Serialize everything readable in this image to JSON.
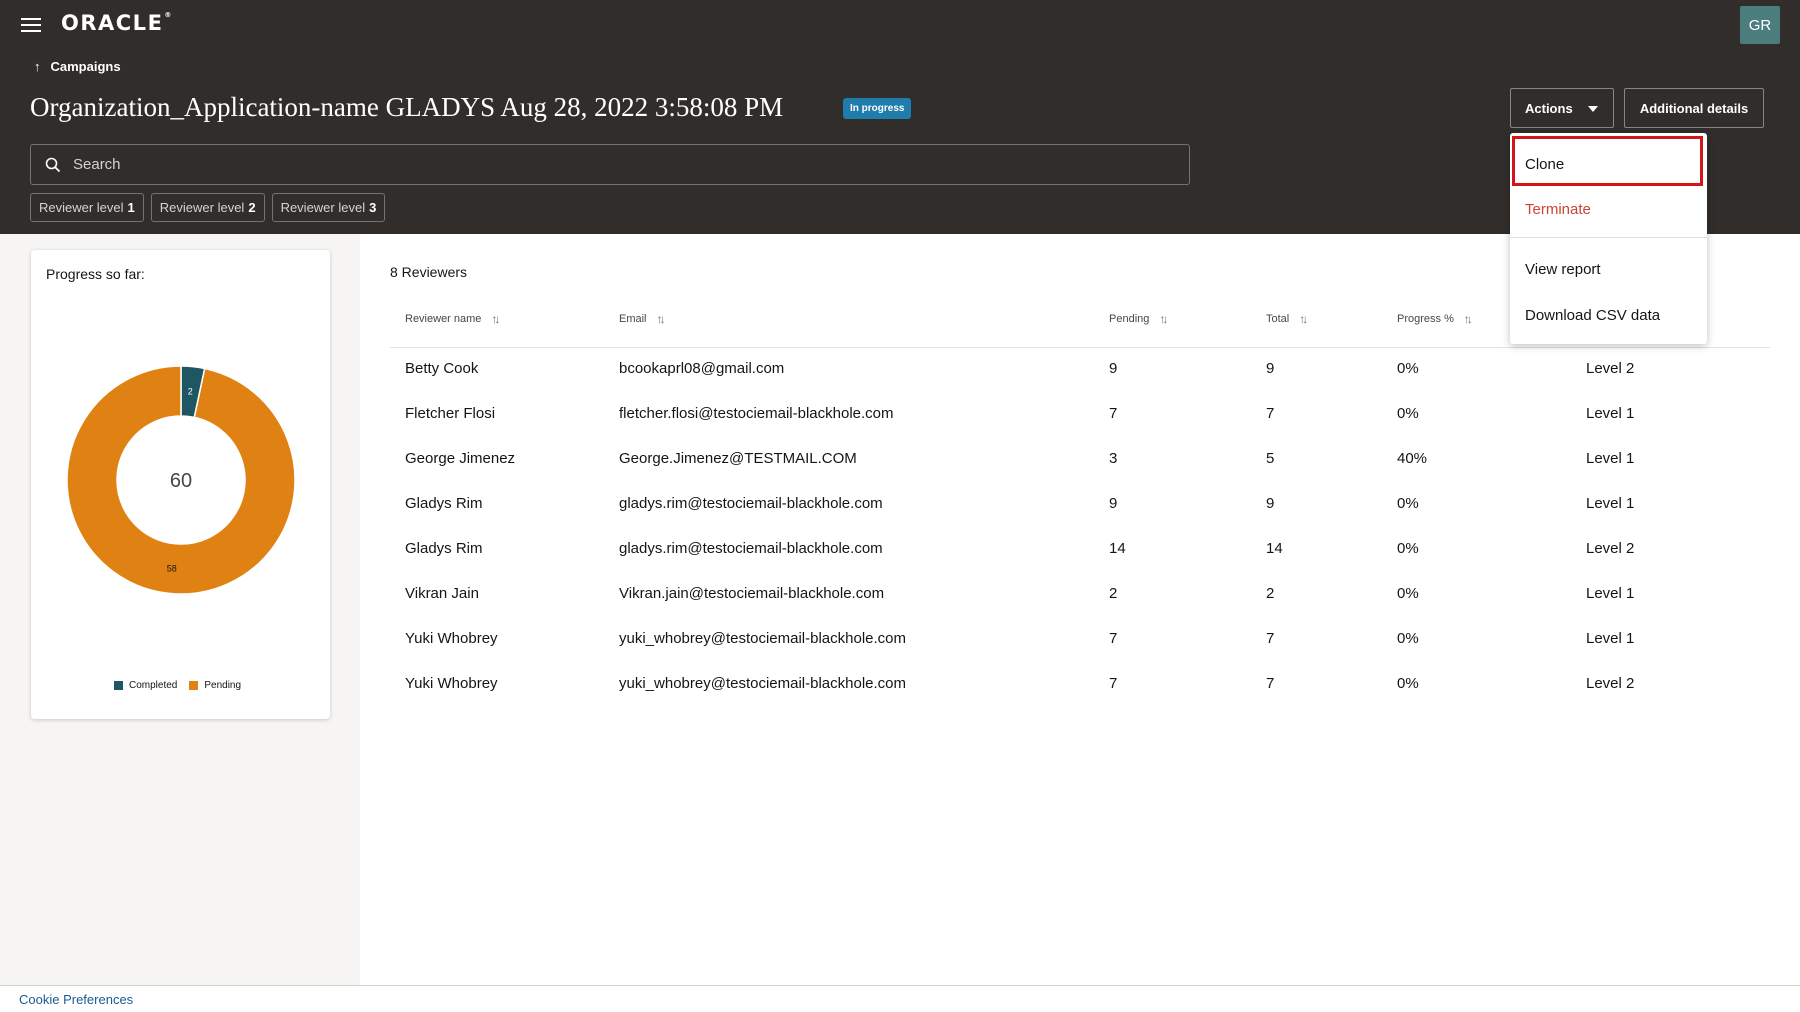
{
  "header": {
    "logo_text": "ORACLE",
    "logo_mark": "®",
    "avatar_initials": "GR"
  },
  "breadcrumb": {
    "label": "Campaigns"
  },
  "page": {
    "title": "Organization_Application-name GLADYS Aug 28, 2022 3:58:08 PM",
    "status": "In progress",
    "actions_label": "Actions",
    "details_label": "Additional details"
  },
  "search": {
    "placeholder": "Search"
  },
  "filters": [
    {
      "prefix": "Reviewer level",
      "level": "1"
    },
    {
      "prefix": "Reviewer level",
      "level": "2"
    },
    {
      "prefix": "Reviewer level",
      "level": "3"
    }
  ],
  "progress": {
    "title": "Progress so far:",
    "total": "60",
    "completed_label": "2",
    "pending_label": "58",
    "legend_completed": "Completed",
    "legend_pending": "Pending"
  },
  "chart_data": {
    "type": "pie",
    "categories": [
      "Completed",
      "Pending"
    ],
    "values": [
      2,
      58
    ],
    "center_label": "60",
    "colors": [
      "#1f5664",
      "#e08213"
    ],
    "legend": "bottom"
  },
  "reviewers": {
    "count_label": "8 Reviewers",
    "columns": [
      "Reviewer name",
      "Email",
      "Pending",
      "Total",
      "Progress %"
    ],
    "rows": [
      {
        "name": "Betty Cook",
        "email": "bcookaprl08@gmail.com",
        "pending": "9",
        "total": "9",
        "progress": "0%",
        "level": "Level 2"
      },
      {
        "name": "Fletcher Flosi",
        "email": "fletcher.flosi@testociemail-blackhole.com",
        "pending": "7",
        "total": "7",
        "progress": "0%",
        "level": "Level 1"
      },
      {
        "name": "George Jimenez",
        "email": "George.Jimenez@TESTMAIL.COM",
        "pending": "3",
        "total": "5",
        "progress": "40%",
        "level": "Level 1"
      },
      {
        "name": "Gladys Rim",
        "email": "gladys.rim@testociemail-blackhole.com",
        "pending": "9",
        "total": "9",
        "progress": "0%",
        "level": "Level 1"
      },
      {
        "name": "Gladys Rim",
        "email": "gladys.rim@testociemail-blackhole.com",
        "pending": "14",
        "total": "14",
        "progress": "0%",
        "level": "Level 2"
      },
      {
        "name": "Vikran Jain",
        "email": "Vikran.jain@testociemail-blackhole.com",
        "pending": "2",
        "total": "2",
        "progress": "0%",
        "level": "Level 1"
      },
      {
        "name": "Yuki Whobrey",
        "email": "yuki_whobrey@testociemail-blackhole.com",
        "pending": "7",
        "total": "7",
        "progress": "0%",
        "level": "Level 1"
      },
      {
        "name": "Yuki Whobrey",
        "email": "yuki_whobrey@testociemail-blackhole.com",
        "pending": "7",
        "total": "7",
        "progress": "0%",
        "level": "Level 2"
      }
    ]
  },
  "actions_menu": {
    "items": [
      "Clone",
      "Terminate",
      "View report",
      "Download CSV data"
    ],
    "highlighted": "Clone"
  },
  "footer": {
    "cookie_link": "Cookie Preferences"
  },
  "colors": {
    "header_bg": "#312d2a",
    "status_badge": "#1f7cab",
    "terminate": "#c74634",
    "highlight_border": "#d4151c",
    "completed": "#1f5664",
    "pending": "#e08213"
  }
}
